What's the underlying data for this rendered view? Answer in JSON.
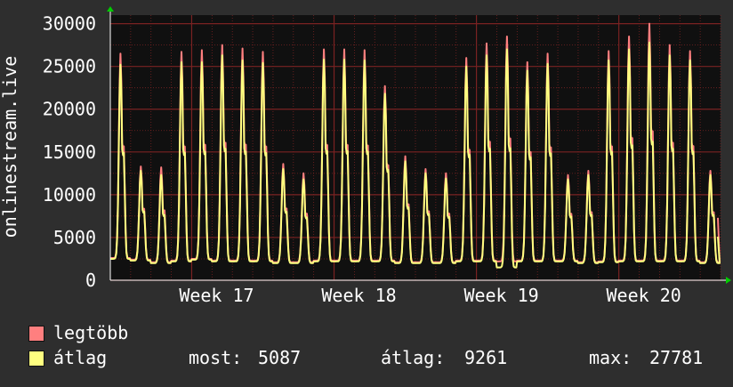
{
  "chart_data": {
    "type": "line",
    "title": "",
    "xlabel": "",
    "ylabel": "onlinestream.live",
    "ylim": [
      0,
      31000
    ],
    "yticks": [
      0,
      5000,
      10000,
      15000,
      20000,
      25000,
      30000
    ],
    "yticklabels": [
      "0",
      "5000",
      "10000",
      "15000",
      "20000",
      "25000",
      "30000"
    ],
    "xticklabels": [
      "Week 17",
      "Week 18",
      "Week 19",
      "Week 20"
    ],
    "days": 30,
    "grid": true,
    "series": [
      {
        "name": "legtöbb",
        "color": "#ff7f7f",
        "daily_values": [
          26500,
          13300,
          13200,
          26700,
          26900,
          27500,
          27100,
          26700,
          13600,
          12500,
          27000,
          27000,
          26900,
          22700,
          14500,
          13000,
          12500,
          26000,
          27700,
          28500,
          25500,
          26500,
          12300,
          12800,
          26800,
          28500,
          30000,
          27500,
          26800,
          12800
        ],
        "daily_lows": [
          2600,
          2400,
          2100,
          2300,
          2500,
          2300,
          2300,
          2300,
          2100,
          2100,
          2300,
          2300,
          2300,
          2300,
          2100,
          2100,
          2100,
          2300,
          2300,
          2200,
          2300,
          2300,
          2300,
          2100,
          2200,
          2300,
          2300,
          2300,
          2300,
          2100
        ],
        "last": 7300
      },
      {
        "name": "átlag",
        "color": "#ffff80",
        "daily_values": [
          25200,
          12800,
          12300,
          25500,
          25500,
          26300,
          25700,
          25400,
          13000,
          11800,
          25800,
          25800,
          25700,
          21800,
          13900,
          12500,
          11900,
          25000,
          26300,
          27000,
          24500,
          25300,
          11800,
          12300,
          25700,
          27000,
          27800,
          26300,
          25700,
          12300
        ],
        "daily_lows": [
          2500,
          2300,
          2000,
          2200,
          2400,
          2200,
          2200,
          2200,
          2000,
          2000,
          2200,
          2200,
          2200,
          2200,
          2000,
          2000,
          2000,
          2200,
          2200,
          1500,
          2200,
          2200,
          2200,
          2000,
          2100,
          2200,
          2200,
          2200,
          2200,
          2000
        ],
        "last": 5087
      }
    ],
    "stats": {
      "most_label": "most:",
      "most_value": "5087",
      "avg_label": "átlag:",
      "avg_value": "9261",
      "max_label": "max:",
      "max_value": "27781"
    }
  },
  "colors": {
    "background": "#2e2e2e",
    "canvas": "#101010",
    "grid": "#7a2222",
    "axis": "#ffffff",
    "arrow": "#00cc00",
    "text": "#ffffff"
  }
}
